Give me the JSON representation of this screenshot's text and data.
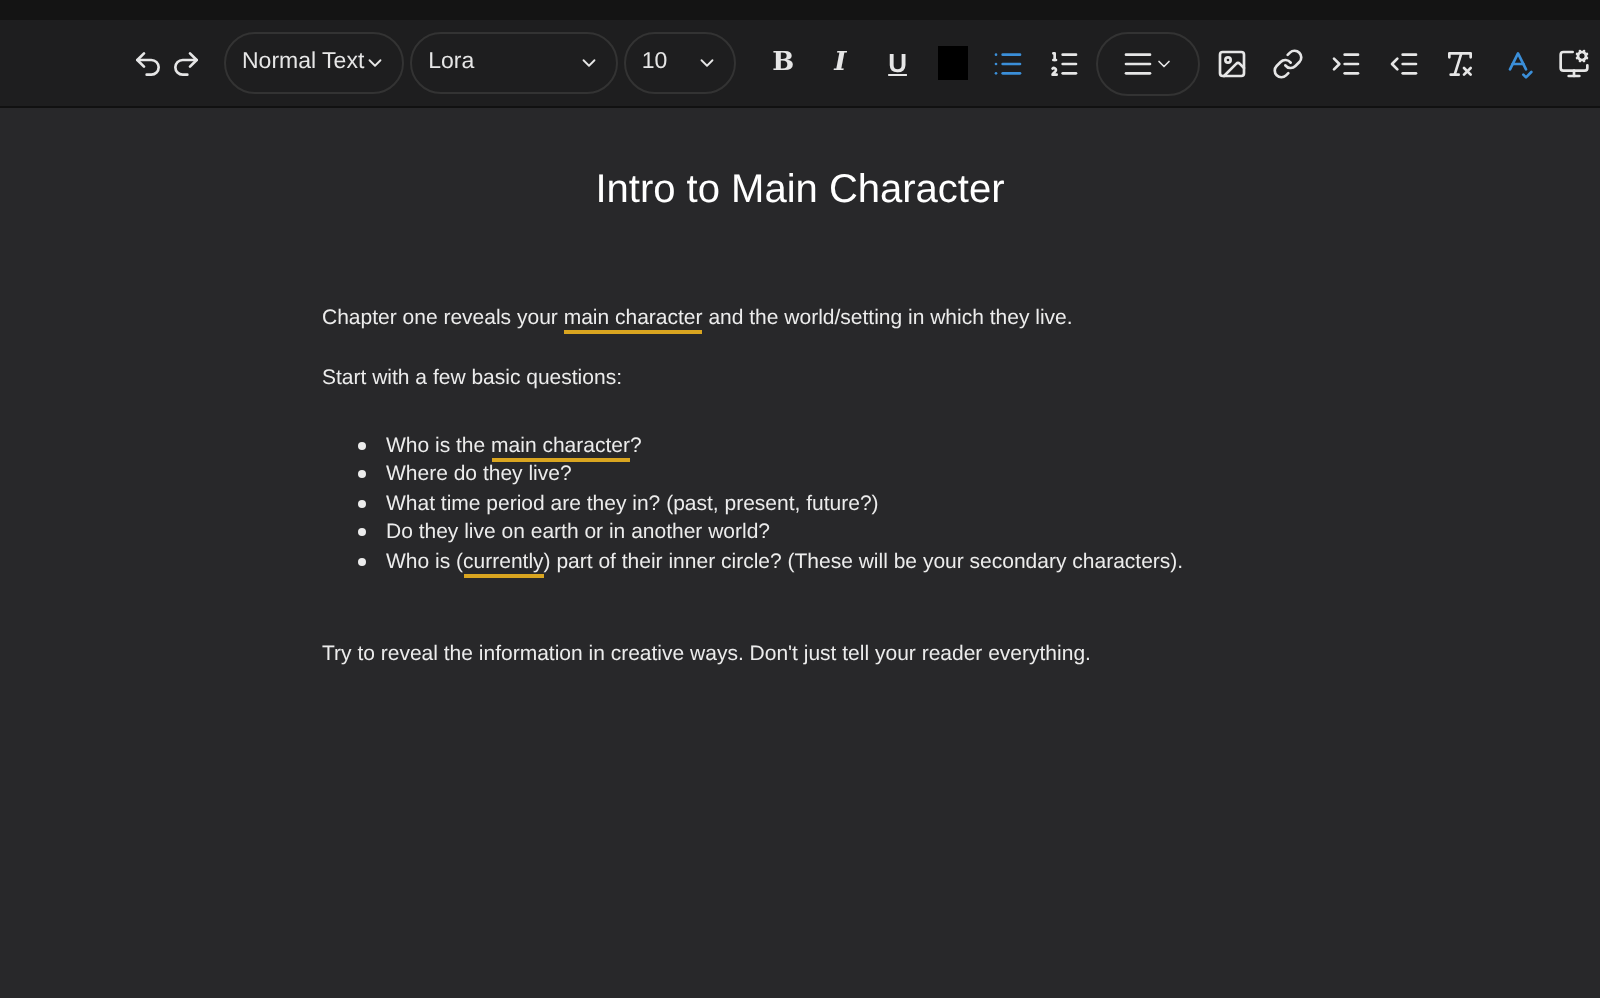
{
  "toolbar": {
    "style_select": "Normal Text",
    "font_select": "Lora",
    "size_select": "10",
    "buttons": [
      {
        "kind": "bold",
        "label": "B",
        "selected": false
      },
      {
        "kind": "italic",
        "label": "I",
        "selected": false
      },
      {
        "kind": "underline",
        "label": "U",
        "selected": false
      },
      {
        "kind": "color"
      },
      {
        "kind": "bullets",
        "selected": true
      },
      {
        "kind": "numbered",
        "selected": false
      },
      {
        "kind": "align",
        "selected": false
      },
      {
        "kind": "image",
        "selected": false
      },
      {
        "kind": "link",
        "selected": false
      },
      {
        "kind": "indent",
        "selected": false
      },
      {
        "kind": "outdent",
        "selected": false
      },
      {
        "kind": "clear",
        "selected": false
      },
      {
        "kind": "spellcheck",
        "selected": true
      },
      {
        "kind": "theme",
        "selected": false
      }
    ]
  },
  "document": {
    "title": "Intro to Main Character",
    "blocks": [
      {
        "kind": "paragraph",
        "segments": [
          {
            "text": "Chapter one reveals your ",
            "marked": false
          },
          {
            "text": "main character",
            "marked": true
          },
          {
            "text": " and the world/setting in which they live.",
            "marked": false
          }
        ]
      },
      {
        "kind": "paragraph",
        "segments": [
          {
            "text": "Start with a few basic questions:",
            "marked": false
          }
        ]
      },
      {
        "kind": "list",
        "items": [
          [
            {
              "text": "Who is the ",
              "marked": false
            },
            {
              "text": "main character",
              "marked": true
            },
            {
              "text": "?",
              "marked": false
            }
          ],
          [
            {
              "text": "Where do they live?",
              "marked": false
            }
          ],
          [
            {
              "text": "What time period are they in? (past, present, future?)",
              "marked": false
            }
          ],
          [
            {
              "text": "Do they live on earth or in another world?",
              "marked": false
            }
          ],
          [
            {
              "text": "Who is (",
              "marked": false
            },
            {
              "text": "currently",
              "marked": true
            },
            {
              "text": ") part of their inner circle? (These will be your secondary characters).",
              "marked": false
            }
          ]
        ]
      },
      {
        "kind": "paragraph",
        "segments": [
          {
            "text": "Try to reveal the information in creative ways. Don't just tell your reader everything.",
            "marked": false
          }
        ]
      }
    ]
  }
}
